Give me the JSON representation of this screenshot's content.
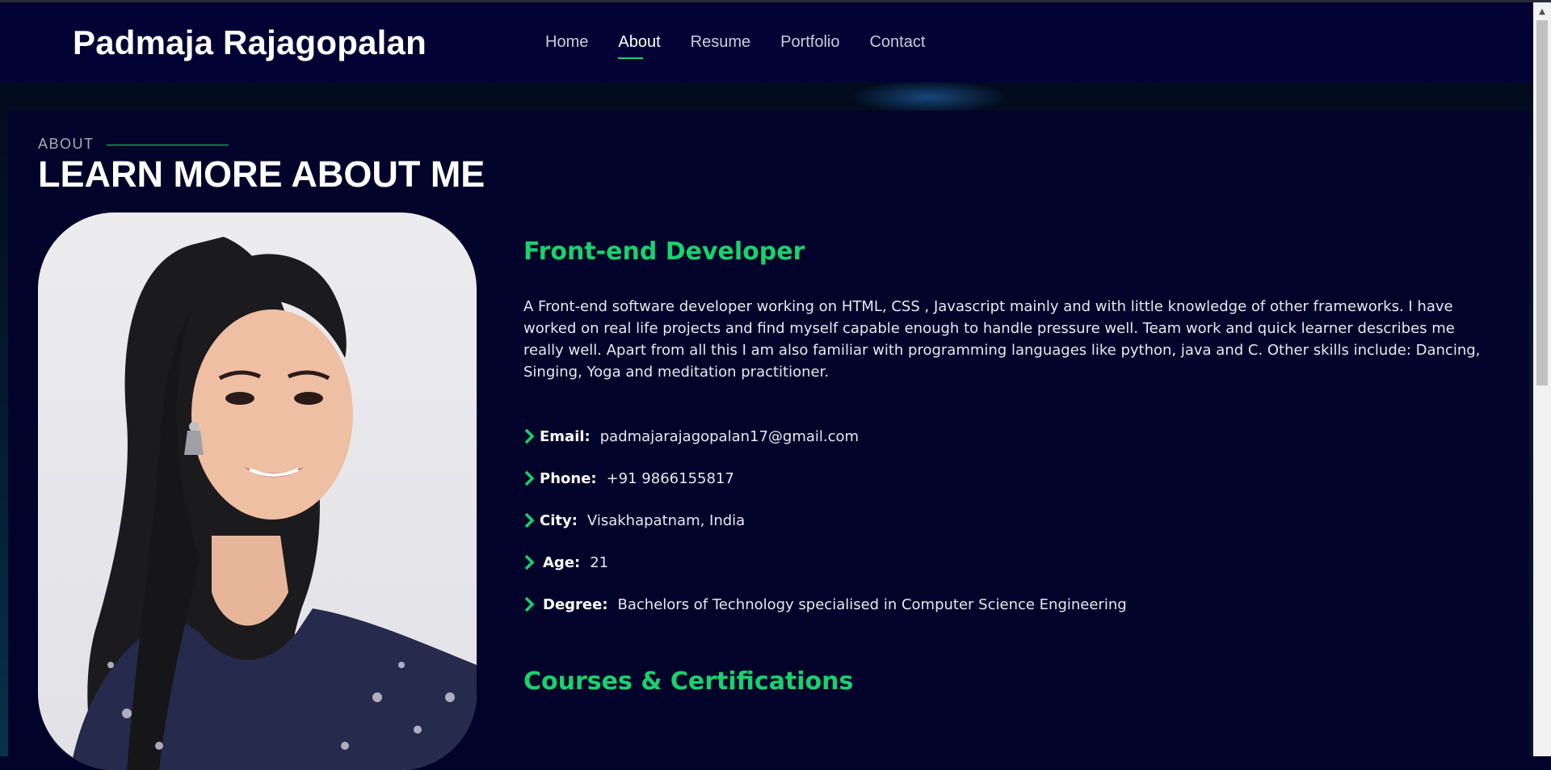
{
  "header": {
    "brand": "Padmaja Rajagopalan",
    "nav": [
      {
        "label": "Home",
        "active": false
      },
      {
        "label": "About",
        "active": true
      },
      {
        "label": "Resume",
        "active": false
      },
      {
        "label": "Portfolio",
        "active": false
      },
      {
        "label": "Contact",
        "active": false
      }
    ]
  },
  "about": {
    "section_label": "ABOUT",
    "section_title": "LEARN MORE ABOUT ME",
    "role_title": "Front-end Developer",
    "bio": "A Front-end software developer working on HTML, CSS , Javascript mainly and with little knowledge of other frameworks. I have worked on real life projects and find myself capable enough to handle pressure well. Team work and quick learner describes me really well. Apart from all this I am also familiar with programming languages like python, java and C. Other skills include: Dancing, Singing, Yoga and meditation practitioner.",
    "info": [
      {
        "key": "Email:",
        "value": "padmajarajagopalan17@gmail.com"
      },
      {
        "key": "Phone:",
        "value": "+91 9866155817"
      },
      {
        "key": "City:",
        "value": "Visakhapatnam, India"
      },
      {
        "key": "Age:",
        "value": "21"
      },
      {
        "key": "Degree:",
        "value": "Bachelors of Technology specialised in Computer Science Engineering"
      }
    ],
    "courses_title": "Courses & Certifications"
  },
  "colors": {
    "accent": "#18d26e",
    "background": "#02032a",
    "header": "#020334"
  },
  "icons": {
    "bullet": "chevron-right-icon",
    "scroll_up": "arrow-up-icon"
  }
}
